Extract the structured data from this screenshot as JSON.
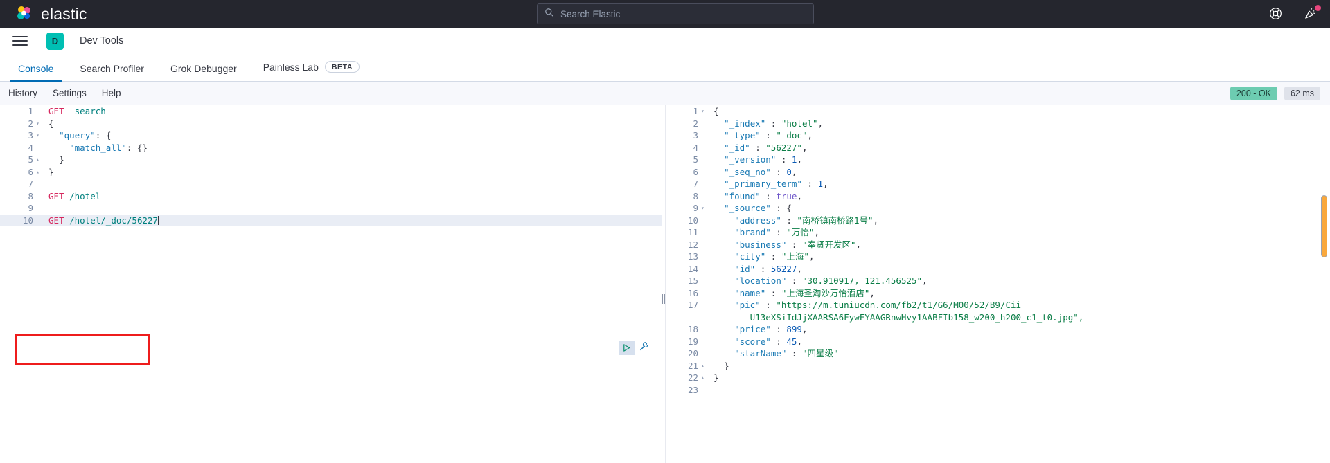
{
  "topbar": {
    "brand_name": "elastic",
    "logo_icon": "elastic-logo-icon",
    "search": {
      "placeholder": "Search Elastic",
      "value": "",
      "icon": "search-icon"
    },
    "help_icon": "help-lifebuoy-icon",
    "news_icon": "announcement-megaphone-icon",
    "news_has_badge": true,
    "badge_color": "#e7457d"
  },
  "appnav": {
    "menu_icon": "hamburger-menu-icon",
    "app_badge_letter": "D",
    "app_badge_color": "#00bfb3",
    "app_title": "Dev Tools"
  },
  "tabs": [
    {
      "label": "Console",
      "active": true,
      "badge": ""
    },
    {
      "label": "Search Profiler",
      "active": false,
      "badge": ""
    },
    {
      "label": "Grok Debugger",
      "active": false,
      "badge": ""
    },
    {
      "label": "Painless Lab",
      "active": false,
      "badge": "BETA"
    }
  ],
  "console_toolbar": {
    "links": [
      "History",
      "Settings",
      "Help"
    ],
    "status_code": "200 - OK",
    "status_color": "#6dccb1",
    "duration": "62 ms"
  },
  "editor": {
    "play_icon": "play-send-request-icon",
    "wrench_icon": "wrench-settings-icon",
    "active_line": 10,
    "annotation_color": "#ee1c1c",
    "lines": [
      {
        "n": "1",
        "fold": "",
        "text": "GET _search"
      },
      {
        "n": "2",
        "fold": "▾",
        "text": "{"
      },
      {
        "n": "3",
        "fold": "▾",
        "text": "  \"query\": {"
      },
      {
        "n": "4",
        "fold": "",
        "text": "    \"match_all\": {}"
      },
      {
        "n": "5",
        "fold": "▴",
        "text": "  }"
      },
      {
        "n": "6",
        "fold": "▴",
        "text": "}"
      },
      {
        "n": "7",
        "fold": "",
        "text": ""
      },
      {
        "n": "8",
        "fold": "",
        "text": "GET /hotel"
      },
      {
        "n": "9",
        "fold": "",
        "text": ""
      },
      {
        "n": "10",
        "fold": "",
        "text": "GET /hotel/_doc/56227"
      }
    ]
  },
  "response": {
    "scrollbar_color": "#f9a83c",
    "lines": [
      {
        "n": "1",
        "fold": "▾",
        "text": "{"
      },
      {
        "n": "2",
        "fold": "",
        "text": "  \"_index\" : \"hotel\","
      },
      {
        "n": "3",
        "fold": "",
        "text": "  \"_type\" : \"_doc\","
      },
      {
        "n": "4",
        "fold": "",
        "text": "  \"_id\" : \"56227\","
      },
      {
        "n": "5",
        "fold": "",
        "text": "  \"_version\" : 1,"
      },
      {
        "n": "6",
        "fold": "",
        "text": "  \"_seq_no\" : 0,"
      },
      {
        "n": "7",
        "fold": "",
        "text": "  \"_primary_term\" : 1,"
      },
      {
        "n": "8",
        "fold": "",
        "text": "  \"found\" : true,"
      },
      {
        "n": "9",
        "fold": "▾",
        "text": "  \"_source\" : {"
      },
      {
        "n": "10",
        "fold": "",
        "text": "    \"address\" : \"南桥镇南桥路1号\","
      },
      {
        "n": "11",
        "fold": "",
        "text": "    \"brand\" : \"万怡\","
      },
      {
        "n": "12",
        "fold": "",
        "text": "    \"business\" : \"奉贤开发区\","
      },
      {
        "n": "13",
        "fold": "",
        "text": "    \"city\" : \"上海\","
      },
      {
        "n": "14",
        "fold": "",
        "text": "    \"id\" : 56227,"
      },
      {
        "n": "15",
        "fold": "",
        "text": "    \"location\" : \"30.910917, 121.456525\","
      },
      {
        "n": "16",
        "fold": "",
        "text": "    \"name\" : \"上海圣淘沙万怡酒店\","
      },
      {
        "n": "17",
        "fold": "",
        "text": "    \"pic\" : \"https://m.tuniucdn.com/fb2/t1/G6/M00/52/B9/Cii"
      },
      {
        "n": "",
        "fold": "",
        "text": "      -U13eXSiIdJjXAARSA6FywFYAAGRnwHvy1AABFIb158_w200_h200_c1_t0.jpg\","
      },
      {
        "n": "18",
        "fold": "",
        "text": "    \"price\" : 899,"
      },
      {
        "n": "19",
        "fold": "",
        "text": "    \"score\" : 45,"
      },
      {
        "n": "20",
        "fold": "",
        "text": "    \"starName\" : \"四星级\""
      },
      {
        "n": "21",
        "fold": "▴",
        "text": "  }"
      },
      {
        "n": "22",
        "fold": "▴",
        "text": "}"
      },
      {
        "n": "23",
        "fold": "",
        "text": ""
      }
    ]
  },
  "response_doc": {
    "_index": "hotel",
    "_type": "_doc",
    "_id": "56227",
    "_version": 1,
    "_seq_no": 0,
    "_primary_term": 1,
    "found": true,
    "_source": {
      "address": "南桥镇南桥路1号",
      "brand": "万怡",
      "business": "奉贤开发区",
      "city": "上海",
      "id": 56227,
      "location": "30.910917, 121.456525",
      "name": "上海圣淘沙万怡酒店",
      "pic": "https://m.tuniucdn.com/fb2/t1/G6/M00/52/B9/Cii-U13eXSiIdJjXAARSA6FywFYAAGRnwHvy1AABFIb158_w200_h200_c1_t0.jpg",
      "price": 899,
      "score": 45,
      "starName": "四星级"
    }
  }
}
